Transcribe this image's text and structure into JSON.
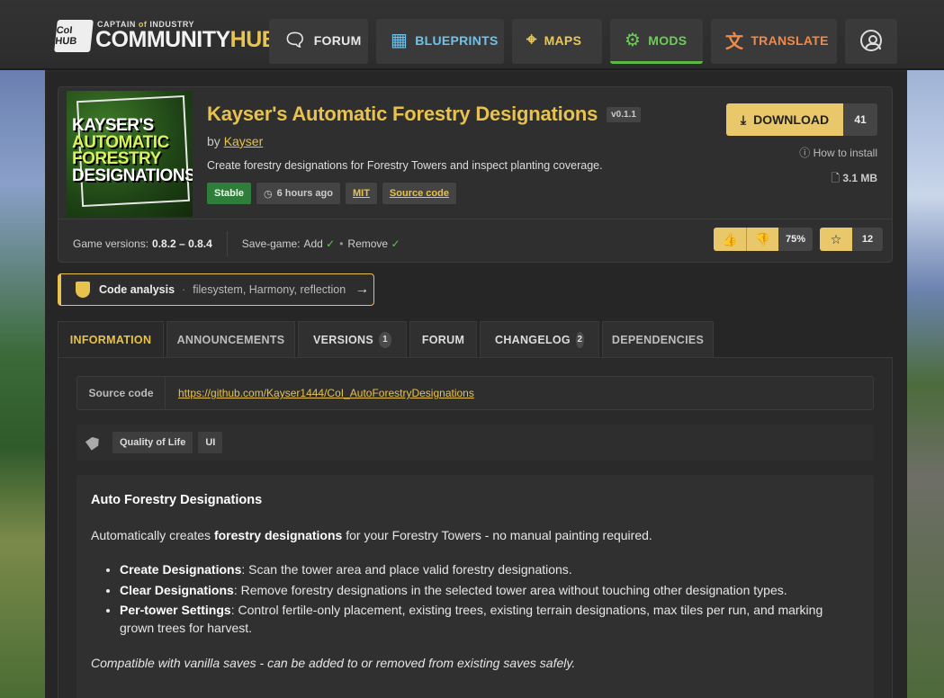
{
  "header": {
    "logo_badge": "CoI HUB",
    "logo_small_pre": "CAPTAIN ",
    "logo_small_of": "of",
    "logo_small_post": " INDUSTRY",
    "logo_big_a": "COMMUNITY",
    "logo_big_b": "HUB",
    "nav": {
      "forum": "FORUM",
      "blueprints": "BLUEPRINTS",
      "maps": "MAPS",
      "mods": "MODS",
      "translate": "TRANSLATE"
    },
    "colors": {
      "blueprints": "#6fc3ea",
      "maps": "#e8c85a",
      "mods": "#6dcc58",
      "translate": "#f08a4b"
    }
  },
  "mod": {
    "thumb_lines": [
      "KAYSER'S",
      "AUTOMATIC",
      "FORESTRY",
      "DESIGNATIONS"
    ],
    "title": "Kayser's Automatic Forestry Designations",
    "version": "v0.1.1",
    "by_label": "by",
    "author": "Kayser",
    "description": "Create forestry designations for Forestry Towers and inspect planting coverage.",
    "tags": {
      "stable": "Stable",
      "updated": "6 hours ago",
      "license": "MIT",
      "source": "Source code"
    },
    "download_label": "DOWNLOAD",
    "download_count": "41",
    "how_to_install": "How to install",
    "file_size": "3.1 MB",
    "game_versions_label": "Game versions:",
    "game_versions": "0.8.2 – 0.8.4",
    "savegame_label": "Save-game:",
    "savegame_add": "Add",
    "savegame_remove": "Remove",
    "approval": "75%",
    "stars": "12"
  },
  "code_analysis": {
    "title": "Code analysis",
    "items": "filesystem, Harmony, reflection"
  },
  "tabs": [
    {
      "label": "INFORMATION",
      "count": ""
    },
    {
      "label": "ANNOUNCEMENTS",
      "count": ""
    },
    {
      "label": "VERSIONS",
      "count": "1"
    },
    {
      "label": "FORUM",
      "count": ""
    },
    {
      "label": "CHANGELOG",
      "count": "2"
    },
    {
      "label": "DEPENDENCIES",
      "count": ""
    }
  ],
  "info": {
    "source_label": "Source code",
    "source_url": "https://github.com/Kayser1444/CoI_AutoForestryDesignations",
    "categories": [
      "Quality of Life",
      "UI"
    ],
    "heading": "Auto Forestry Designations",
    "intro_pre": "Automatically creates ",
    "intro_bold": "forestry designations",
    "intro_post": " for your Forestry Towers - no manual painting required.",
    "features": [
      {
        "name": "Create Designations",
        "text": ": Scan the tower area and place valid forestry designations."
      },
      {
        "name": "Clear Designations",
        "text": ": Remove forestry designations in the selected tower area without touching other designation types."
      },
      {
        "name": "Per-tower Settings",
        "text": ": Control fertile-only placement, existing trees, existing terrain designations, max tiles per run, and marking grown trees for harvest."
      }
    ],
    "compat": "Compatible with vanilla saves - can be added to or removed from existing saves safely."
  }
}
